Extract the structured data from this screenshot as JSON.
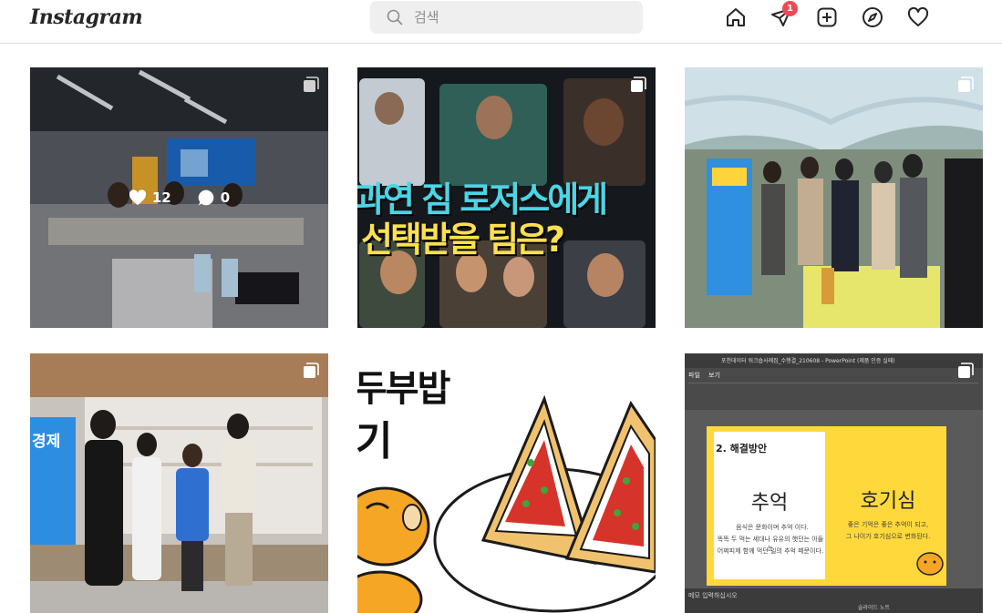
{
  "app": {
    "logo": "Instagram"
  },
  "search": {
    "placeholder": "검색"
  },
  "nav": {
    "icons": [
      "home-icon",
      "direct-message-icon",
      "new-post-icon",
      "explore-icon",
      "activity-heart-icon"
    ],
    "message_badge": "1"
  },
  "posts": [
    {
      "kind": "photo",
      "subject": "meeting room",
      "multi": true,
      "hover": {
        "likes": "12",
        "comments": "0"
      }
    },
    {
      "kind": "thumbnail",
      "multi": true,
      "caption_line1": "과연 짐 로저스에게",
      "caption_line2": "선택받을 팀은?"
    },
    {
      "kind": "photo",
      "subject": "event in greenhouse tent",
      "multi": true
    },
    {
      "kind": "photo",
      "subject": "group photo",
      "multi": true,
      "banner_text": "경제"
    },
    {
      "kind": "illustration",
      "text_line1": "두부밥",
      "text_line2": "기"
    },
    {
      "kind": "slide",
      "multi": true,
      "window_title": "포천데이터 워크숍사례집_수행결_210608 - PowerPoint (제품 인증 실패)",
      "menu": [
        "파일",
        "보기"
      ],
      "slide_heading": "2. 해결방안",
      "left_word": "추억",
      "left_desc_1": "음식은 문화이며 추억 이다.",
      "left_desc_2": "똑똑 두 먹는 세대나 유유의 햇던는 아들는",
      "left_desc_3": "어쩌피제 함께 먹던 일의 추억 떼문이다.",
      "right_word": "호기심",
      "right_desc_1": "좋은 기억은 좋은 추억이 되고,",
      "right_desc_2": "그 나이가 호기심으로 변화된다.",
      "status_left": "메모 입력하십시오",
      "status_right": "슬라이드 노트"
    }
  ],
  "colors": {
    "accent_red": "#ed4956",
    "search_bg": "#efefef",
    "caption_cyan": "#49d6e6",
    "caption_yellow": "#ffe14d",
    "slide_yellow": "#ffd93b"
  }
}
